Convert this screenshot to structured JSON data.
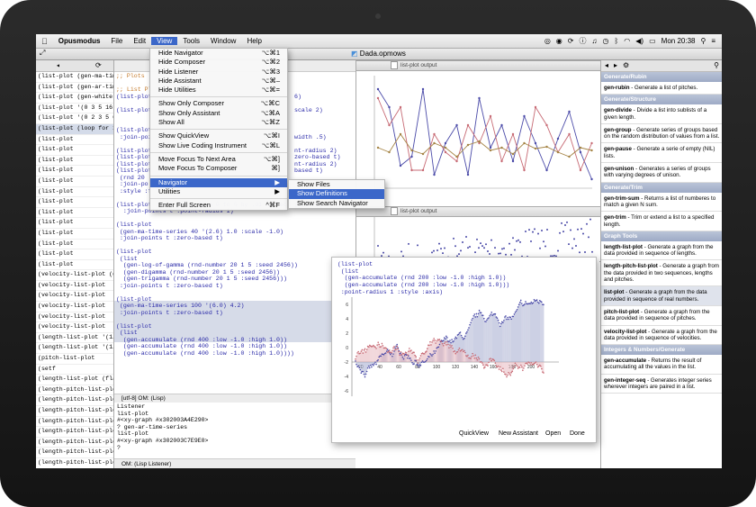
{
  "menubar": {
    "app_name": "Opusmodus",
    "menus": [
      "File",
      "Edit",
      "View",
      "Tools",
      "Window",
      "Help"
    ],
    "clock": "Mon 20:38"
  },
  "window": {
    "title": "Dada.opmows"
  },
  "view_menu": {
    "items": [
      {
        "label": "Hide Navigator",
        "key": "⌥⌘1"
      },
      {
        "label": "Hide Composer",
        "key": "⌥⌘2"
      },
      {
        "label": "Hide Listener",
        "key": "⌥⌘3"
      },
      {
        "label": "Hide Assistant",
        "key": "⌥⌘–"
      },
      {
        "label": "Hide Utilities",
        "key": "⌥⌘="
      },
      {
        "label": "Show Only Composer",
        "key": "⌥⌘C"
      },
      {
        "label": "Show Only Assistant",
        "key": "⌥⌘A"
      },
      {
        "label": "Show All",
        "key": "⌥⌘Z"
      },
      {
        "label": "Show QuickView",
        "key": "⌥⌘I"
      },
      {
        "label": "Show Live Coding Instrument",
        "key": "⌥⌘L"
      },
      {
        "label": "Move Focus To Next Area",
        "key": "⌥⌘]"
      },
      {
        "label": "Move Focus To Composer",
        "key": "⌘]"
      },
      {
        "label": "Navigator",
        "key": "▶"
      },
      {
        "label": "Utilities",
        "key": "▶"
      },
      {
        "label": "Enter Full Screen",
        "key": "^⌘F"
      }
    ]
  },
  "navigator_submenu": {
    "items": [
      "Show Files",
      "Show Definitions",
      "Show Search Navigator"
    ]
  },
  "left_list": [
    "(list-plot (gen-ma-time-series",
    "(list-plot (gen-ar-time-se",
    "(list-plot (gen-white-noise",
    "(list-plot '(0 3 5 16 13 14",
    "(list-plot '(0 2 3 5 6 8",
    "(list-plot (loop for x from...",
    "(list-plot",
    "(list-plot",
    "(list-plot",
    "(list-plot",
    "(list-plot",
    "(list-plot",
    "(list-plot",
    "(list-plot",
    "(list-plot",
    "(list-plot",
    "(list-plot",
    "(list-plot",
    "(list-plot",
    "(velocity-list-plot (gen-di",
    "(velocity-list-plot",
    "(velocity-list-plot",
    "(velocity-list-plot",
    "(velocity-list-plot",
    "(velocity-list-plot",
    "(length-list-plot '(1/4 = -",
    "(length-list-plot '(1/2 -1",
    "(pitch-list-plot",
    "(setf",
    "(length-list-plot (flatten (",
    "(length-pitch-list-plot",
    "(length-pitch-list-plot",
    "(length-pitch-list-plot",
    "(length-pitch-list-plot",
    "(length-pitch-list-plot",
    "(length-pitch-list-plot",
    "(length-pitch-list-plot",
    "(length-pitch-list-plot",
    "(length-pitch-list-plot",
    "(length-pitch-list-plot",
    "(length-pitch-list-plot"
  ],
  "editor": {
    "lines": [
      {
        "t": ";; Plots",
        "c": "comment"
      },
      {
        "t": "",
        "c": ""
      },
      {
        "t": ";; List Pl",
        "c": "comment"
      },
      {
        "t": "(list-plot",
        "c": "blue"
      },
      {
        "t": "",
        "c": ""
      },
      {
        "t": "(list-plot",
        "c": "blue"
      },
      {
        "t": "",
        "c": ""
      },
      {
        "t": "",
        "c": ""
      },
      {
        "t": "(list-plot",
        "c": "blue"
      },
      {
        "t": " :join-poi",
        "c": "blue"
      },
      {
        "t": "",
        "c": ""
      },
      {
        "t": "(list-plot",
        "c": "blue"
      },
      {
        "t": "(list-plot",
        "c": "blue"
      },
      {
        "t": "(list-plot",
        "c": "blue"
      },
      {
        "t": "(list-plot",
        "c": "blue"
      },
      {
        "t": " (rnd 20",
        "c": "blue"
      },
      {
        "t": " :join-po",
        "c": "blue"
      },
      {
        "t": " :style :f",
        "c": "blue"
      },
      {
        "t": "",
        "c": ""
      },
      {
        "t": "(list-plot (loop for x from 0 to 6 by .01 collect (sin x))",
        "c": "blue"
      },
      {
        "t": "  :join-points t :point-radius 1)",
        "c": "blue"
      },
      {
        "t": "",
        "c": ""
      },
      {
        "t": "(list-plot",
        "c": "blue"
      },
      {
        "t": " (gen-ma-time-series 40 '(2.6) 1.0 :scale -1.0)",
        "c": "blue"
      },
      {
        "t": " :join-points t :zero-based t)",
        "c": "blue"
      },
      {
        "t": "",
        "c": ""
      },
      {
        "t": "(list-plot",
        "c": "blue"
      },
      {
        "t": " (list",
        "c": "blue"
      },
      {
        "t": "  (gen-log-of-gamma (rnd-number 20 1 5 :seed 2456))",
        "c": "blue"
      },
      {
        "t": "  (gen-digamma (rnd-number 20 1 5 :seed 2456))",
        "c": "blue"
      },
      {
        "t": "  (gen-trigamma (rnd-number 20 1 5 :seed 2456)))",
        "c": "blue"
      },
      {
        "t": " :join-points t :zero-based t)",
        "c": "blue"
      },
      {
        "t": "",
        "c": ""
      },
      {
        "t": "(list-plot",
        "c": "blue"
      },
      {
        "t": " (gen-ma-time-series 100 '(6.0) 4.2)",
        "c": "blue"
      },
      {
        "t": " :join-points t :zero-based t)",
        "c": "blue"
      },
      {
        "t": "",
        "c": ""
      },
      {
        "t": "(list-plot",
        "c": "blue"
      },
      {
        "t": " (list",
        "c": "blue"
      },
      {
        "t": "  (gen-accumulate (rnd 400 :low -1.0 :high 1.0))",
        "c": "blue"
      },
      {
        "t": "  (gen-accumulate (rnd 400 :low -1.0 :high 1.0))",
        "c": "blue"
      },
      {
        "t": "  (gen-accumulate (rnd 400 :low -1.0 :high 1.0))))",
        "c": "blue"
      }
    ],
    "frag_right": [
      {
        "t": "6)",
        "row": 3
      },
      {
        "t": "scale 2)",
        "row": 5
      },
      {
        "t": "width .5)",
        "row": 9
      },
      {
        "t": "nt-radius 2)",
        "row": 11
      },
      {
        "t": "zero-based t)",
        "row": 12
      },
      {
        "t": "nt-radius 2)",
        "row": 13
      },
      {
        "t": "based t)",
        "row": 14
      }
    ],
    "status": "[utf-8] OM:  (Lisp)"
  },
  "listener": {
    "lines": [
      "Listener",
      "list-plot",
      "#<xy-graph #x302003A4E290>",
      "? gen-ar-time-series",
      "list-plot",
      "#<xy-graph #x302003C7E9E0>",
      "?"
    ],
    "status": "OM:  (Lisp Listener)"
  },
  "graphs": {
    "title1": "list-plot output",
    "title2": "list-plot output"
  },
  "popover": {
    "code": [
      "(list-plot",
      " (list",
      "  (gen-accumulate (rnd 200 :low -1.0 :high 1.0))",
      "  (gen-accumulate (rnd 200 :low -1.0 :high 1.0)))",
      " :point-radius 1 :style :axis)"
    ],
    "buttons": [
      "QuickView",
      "New Assistant",
      "Open",
      "Done"
    ],
    "y_ticks": [
      "6",
      "4",
      "2",
      "0",
      "-2",
      "-4",
      "-6"
    ],
    "x_ticks": [
      "20",
      "40",
      "60",
      "80",
      "100",
      "120",
      "140",
      "160",
      "180",
      "200"
    ]
  },
  "assistant": {
    "sections": [
      {
        "title": "Generate/Rubin",
        "entries": [
          {
            "name": "gen-rubin",
            "desc": " - Generate a list of pitches."
          }
        ]
      },
      {
        "title": "Generate/Structure",
        "entries": [
          {
            "name": "gen-divide",
            "desc": " - Divide a list into sublists of a given length."
          },
          {
            "name": "gen-group",
            "desc": " - Generate series of groups based on the random distribution of values from a list."
          },
          {
            "name": "gen-pause",
            "desc": " - Generate a serie of empty (NIL) lists."
          },
          {
            "name": "gen-unison",
            "desc": " - Generates a series of groups with varying degrees of unison."
          }
        ]
      },
      {
        "title": "Generate/Trim",
        "entries": [
          {
            "name": "gen-trim-sum",
            "desc": " - Returns a list of numberes to match a given N sum."
          },
          {
            "name": "gen-trim",
            "desc": " - Trim or extend a list to a specified length."
          }
        ]
      },
      {
        "title": "Graph Tools",
        "entries": [
          {
            "name": "length-list-plot",
            "desc": " - Generate a graph from the data provided in sequence of lengths."
          },
          {
            "name": "length-pitch-list-plot",
            "desc": " - Generate a graph from the data provided in two sequences, lengths and pitches."
          },
          {
            "name": "list-plot",
            "desc": " - Generate a graph from the data provided in sequence of real numbers."
          },
          {
            "name": "pitch-list-plot",
            "desc": " - Generate a graph from the data provided in sequence of pitches."
          },
          {
            "name": "velocity-list-plot",
            "desc": " - Generate a graph from the data provided in sequence of velocities."
          }
        ]
      },
      {
        "title": "Integers & Numbers/Generate",
        "entries": [
          {
            "name": "gen-accumulate",
            "desc": " - Returns the result of accumulating all the values in the list."
          },
          {
            "name": "gen-integer-seq",
            "desc": " - Generates integer series wherever integers are paired in a list."
          }
        ]
      }
    ]
  },
  "colors": {
    "highlight": "#3b67c9",
    "series_blue": "#4a4aa8",
    "series_red": "#c76a74",
    "series_brown": "#a58445"
  }
}
